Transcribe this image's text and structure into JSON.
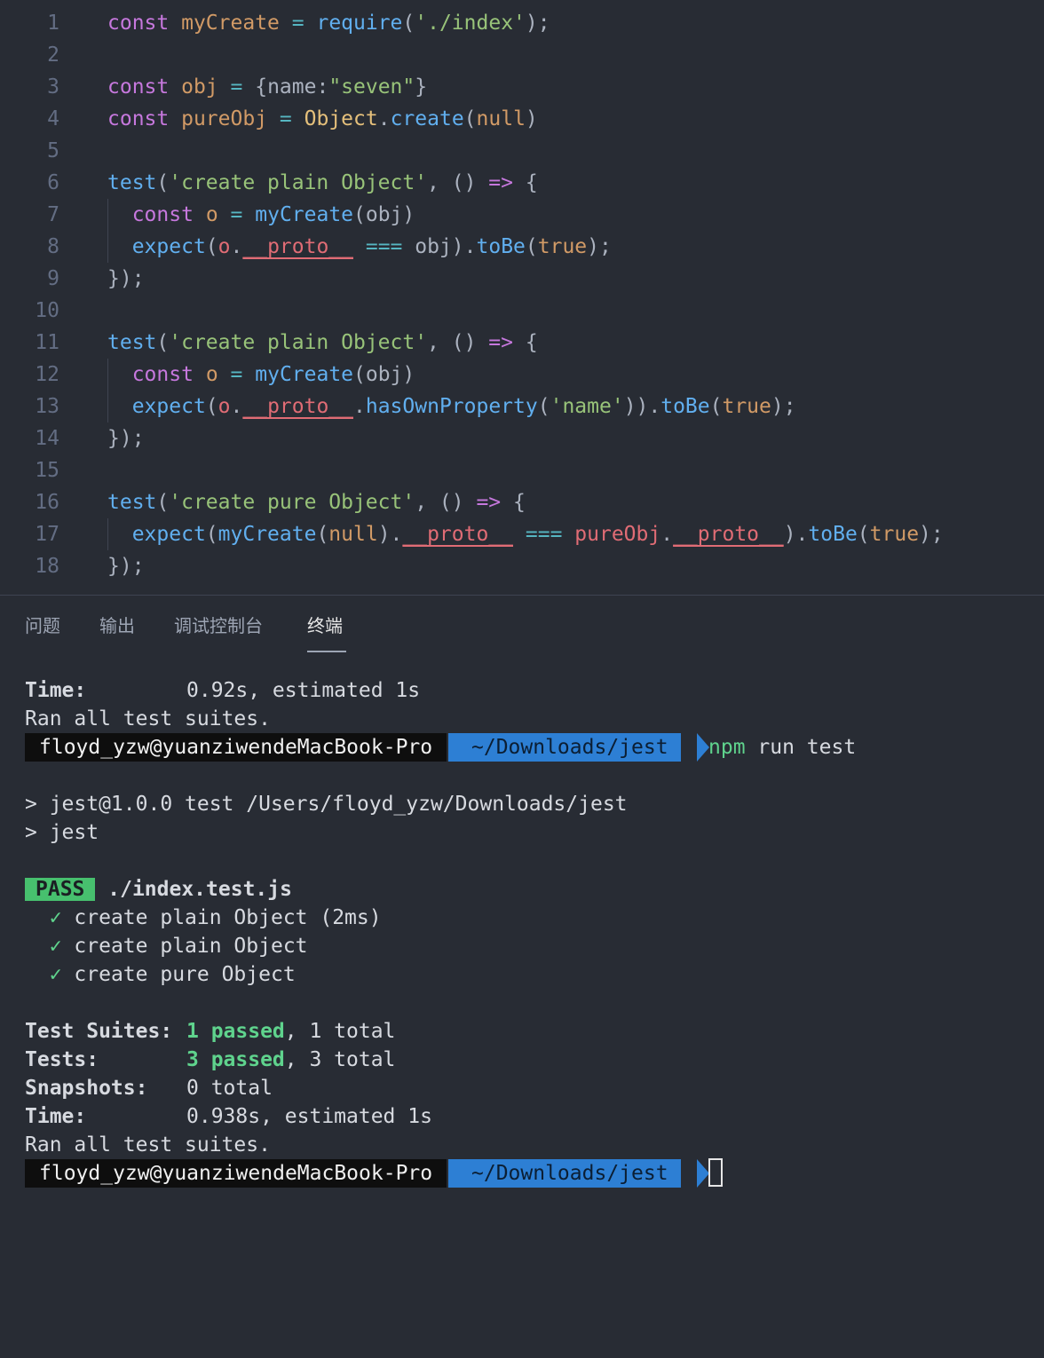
{
  "editor": {
    "lines": [
      {
        "n": "1",
        "tokens": [
          {
            "t": "const",
            "c": "kw"
          },
          {
            "t": " ",
            "c": ""
          },
          {
            "t": "myCreate",
            "c": "num"
          },
          {
            "t": " ",
            "c": ""
          },
          {
            "t": "=",
            "c": "op"
          },
          {
            "t": " ",
            "c": ""
          },
          {
            "t": "require",
            "c": "fn"
          },
          {
            "t": "(",
            "c": ""
          },
          {
            "t": "'./index'",
            "c": "str"
          },
          {
            "t": ");",
            "c": ""
          }
        ]
      },
      {
        "n": "2",
        "tokens": []
      },
      {
        "n": "3",
        "tokens": [
          {
            "t": "const",
            "c": "kw"
          },
          {
            "t": " ",
            "c": ""
          },
          {
            "t": "obj",
            "c": "num"
          },
          {
            "t": " ",
            "c": ""
          },
          {
            "t": "=",
            "c": "op"
          },
          {
            "t": " {name:",
            "c": ""
          },
          {
            "t": "\"seven\"",
            "c": "str"
          },
          {
            "t": "}",
            "c": ""
          }
        ]
      },
      {
        "n": "4",
        "tokens": [
          {
            "t": "const",
            "c": "kw"
          },
          {
            "t": " ",
            "c": ""
          },
          {
            "t": "pureObj",
            "c": "num"
          },
          {
            "t": " ",
            "c": ""
          },
          {
            "t": "=",
            "c": "op"
          },
          {
            "t": " ",
            "c": ""
          },
          {
            "t": "Object",
            "c": "cls"
          },
          {
            "t": ".",
            "c": ""
          },
          {
            "t": "create",
            "c": "fn"
          },
          {
            "t": "(",
            "c": ""
          },
          {
            "t": "null",
            "c": "num"
          },
          {
            "t": ")",
            "c": ""
          }
        ]
      },
      {
        "n": "5",
        "tokens": []
      },
      {
        "n": "6",
        "tokens": [
          {
            "t": "test",
            "c": "fn"
          },
          {
            "t": "(",
            "c": ""
          },
          {
            "t": "'create plain Object'",
            "c": "str"
          },
          {
            "t": ", () ",
            "c": ""
          },
          {
            "t": "=>",
            "c": "kw"
          },
          {
            "t": " {",
            "c": ""
          }
        ]
      },
      {
        "n": "7",
        "tokens": [
          {
            "t": "  ",
            "c": ""
          },
          {
            "t": "const",
            "c": "kw"
          },
          {
            "t": " ",
            "c": ""
          },
          {
            "t": "o",
            "c": "num"
          },
          {
            "t": " ",
            "c": ""
          },
          {
            "t": "=",
            "c": "op"
          },
          {
            "t": " ",
            "c": ""
          },
          {
            "t": "myCreate",
            "c": "fn"
          },
          {
            "t": "(obj)",
            "c": ""
          }
        ]
      },
      {
        "n": "8",
        "tokens": [
          {
            "t": "  ",
            "c": ""
          },
          {
            "t": "expect",
            "c": "fn"
          },
          {
            "t": "(",
            "c": ""
          },
          {
            "t": "o",
            "c": "var"
          },
          {
            "t": ".",
            "c": ""
          },
          {
            "t": "__proto__",
            "c": "var ul"
          },
          {
            "t": " ",
            "c": ""
          },
          {
            "t": "===",
            "c": "op"
          },
          {
            "t": " obj).",
            "c": ""
          },
          {
            "t": "toBe",
            "c": "fn"
          },
          {
            "t": "(",
            "c": ""
          },
          {
            "t": "true",
            "c": "num"
          },
          {
            "t": ");",
            "c": ""
          }
        ]
      },
      {
        "n": "9",
        "tokens": [
          {
            "t": "});",
            "c": ""
          }
        ]
      },
      {
        "n": "10",
        "tokens": []
      },
      {
        "n": "11",
        "tokens": [
          {
            "t": "test",
            "c": "fn"
          },
          {
            "t": "(",
            "c": ""
          },
          {
            "t": "'create plain Object'",
            "c": "str"
          },
          {
            "t": ", () ",
            "c": ""
          },
          {
            "t": "=>",
            "c": "kw"
          },
          {
            "t": " {",
            "c": ""
          }
        ]
      },
      {
        "n": "12",
        "tokens": [
          {
            "t": "  ",
            "c": ""
          },
          {
            "t": "const",
            "c": "kw"
          },
          {
            "t": " ",
            "c": ""
          },
          {
            "t": "o",
            "c": "num"
          },
          {
            "t": " ",
            "c": ""
          },
          {
            "t": "=",
            "c": "op"
          },
          {
            "t": " ",
            "c": ""
          },
          {
            "t": "myCreate",
            "c": "fn"
          },
          {
            "t": "(obj)",
            "c": ""
          }
        ]
      },
      {
        "n": "13",
        "tokens": [
          {
            "t": "  ",
            "c": ""
          },
          {
            "t": "expect",
            "c": "fn"
          },
          {
            "t": "(",
            "c": ""
          },
          {
            "t": "o",
            "c": "var"
          },
          {
            "t": ".",
            "c": ""
          },
          {
            "t": "__proto__",
            "c": "var ul"
          },
          {
            "t": ".",
            "c": ""
          },
          {
            "t": "hasOwnProperty",
            "c": "fn"
          },
          {
            "t": "(",
            "c": ""
          },
          {
            "t": "'name'",
            "c": "str"
          },
          {
            "t": ")).",
            "c": ""
          },
          {
            "t": "toBe",
            "c": "fn"
          },
          {
            "t": "(",
            "c": ""
          },
          {
            "t": "true",
            "c": "num"
          },
          {
            "t": ");",
            "c": ""
          }
        ]
      },
      {
        "n": "14",
        "tokens": [
          {
            "t": "});",
            "c": ""
          }
        ]
      },
      {
        "n": "15",
        "tokens": []
      },
      {
        "n": "16",
        "tokens": [
          {
            "t": "test",
            "c": "fn"
          },
          {
            "t": "(",
            "c": ""
          },
          {
            "t": "'create pure Object'",
            "c": "str"
          },
          {
            "t": ", () ",
            "c": ""
          },
          {
            "t": "=>",
            "c": "kw"
          },
          {
            "t": " {",
            "c": ""
          }
        ]
      },
      {
        "n": "17",
        "tokens": [
          {
            "t": "  ",
            "c": ""
          },
          {
            "t": "expect",
            "c": "fn"
          },
          {
            "t": "(",
            "c": ""
          },
          {
            "t": "myCreate",
            "c": "fn"
          },
          {
            "t": "(",
            "c": ""
          },
          {
            "t": "null",
            "c": "num"
          },
          {
            "t": ").",
            "c": ""
          },
          {
            "t": "__proto__",
            "c": "var ul"
          },
          {
            "t": " ",
            "c": ""
          },
          {
            "t": "===",
            "c": "op"
          },
          {
            "t": " ",
            "c": ""
          },
          {
            "t": "pureObj",
            "c": "var"
          },
          {
            "t": ".",
            "c": ""
          },
          {
            "t": "__proto__",
            "c": "var ul"
          },
          {
            "t": ").",
            "c": ""
          },
          {
            "t": "toBe",
            "c": "fn"
          },
          {
            "t": "(",
            "c": ""
          },
          {
            "t": "true",
            "c": "num"
          },
          {
            "t": ");",
            "c": ""
          }
        ]
      },
      {
        "n": "18",
        "tokens": [
          {
            "t": "});",
            "c": ""
          }
        ]
      }
    ]
  },
  "panel": {
    "tabs": [
      {
        "label": "问题"
      },
      {
        "label": "输出"
      },
      {
        "label": "调试控制台"
      },
      {
        "label": "终端"
      }
    ]
  },
  "terminal": {
    "time1_label": "Time:",
    "time1_value": "0.92s, estimated 1s",
    "ran1": "Ran all test suites.",
    "prompt_host": "floyd_yzw@yuanziwendeMacBook-Pro",
    "prompt_dir": "~/Downloads/jest",
    "cmd_npm": "npm",
    "cmd_rest": " run test",
    "script1": "> jest@1.0.0 test /Users/floyd_yzw/Downloads/jest",
    "script2": "> jest",
    "pass_badge": "PASS",
    "test_file": "./index.test.js",
    "checkmark": "✓",
    "tests": [
      "create plain Object (2ms)",
      "create plain Object",
      "create pure Object"
    ],
    "suites_label": "Test Suites:",
    "suites_passed": "1 passed",
    "suites_total": ", 1 total",
    "tests_label": "Tests:",
    "tests_passed": "3 passed",
    "tests_total": ", 3 total",
    "snapshots_label": "Snapshots:",
    "snapshots_value": "0 total",
    "time2_label": "Time:",
    "time2_value": "0.938s, estimated 1s",
    "ran2": "Ran all test suites.",
    "prompt2_host": "floyd_yzw@yuanziwendeMacBook-Pro",
    "prompt2_dir": "~/Downloads/jest"
  },
  "colors": {
    "background": "#282c34",
    "pass_green": "#47c06e",
    "prompt_blue": "#2d7fd4"
  }
}
